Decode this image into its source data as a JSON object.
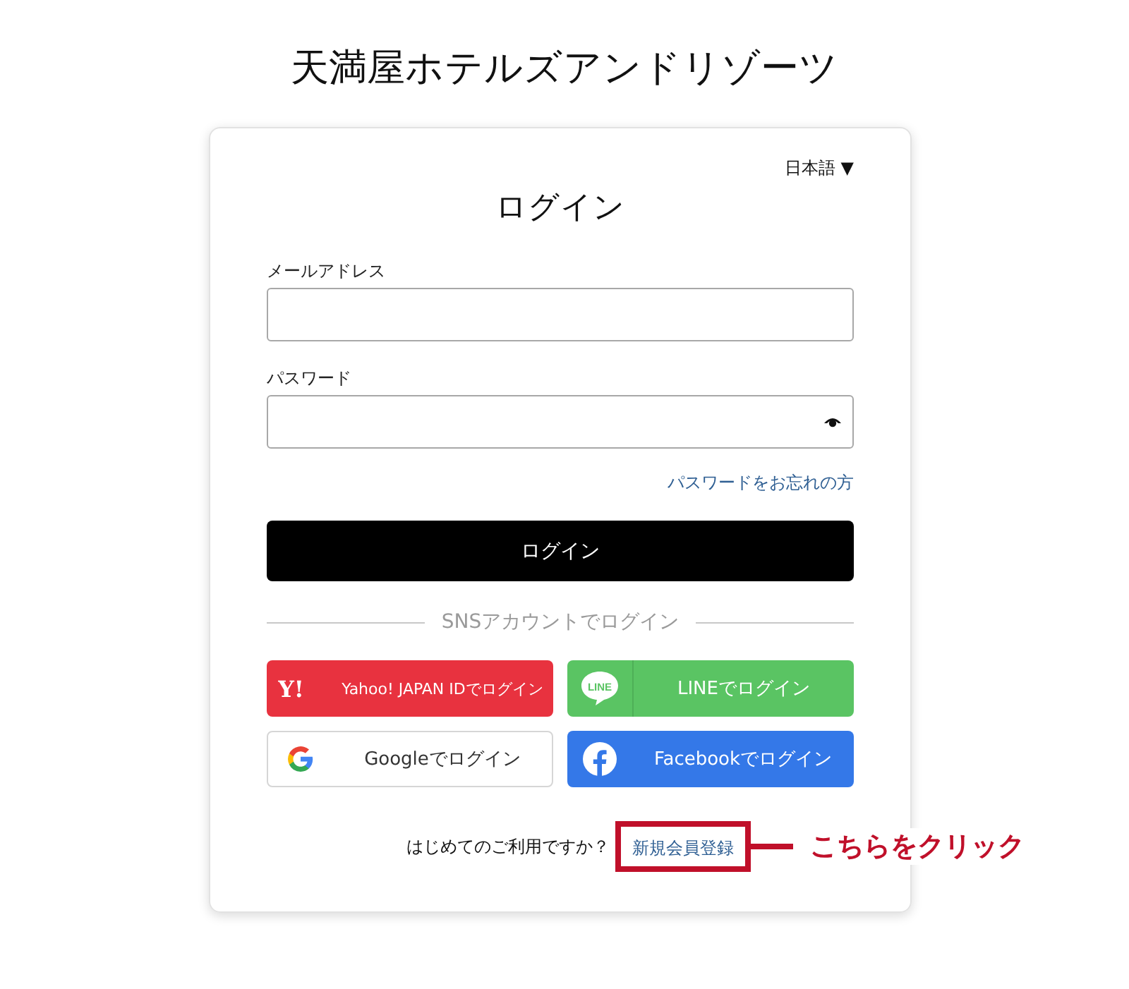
{
  "page_title": "天満屋ホテルズアンドリゾーツ",
  "language": {
    "label": "日本語",
    "caret": "▼"
  },
  "heading": "ログイン",
  "fields": [
    {
      "kind": "text",
      "label": "メールアドレス"
    },
    {
      "kind": "password",
      "label": "パスワード"
    }
  ],
  "forgot_link": "パスワードをお忘れの方",
  "login_button": "ログイン",
  "divider": "SNSアカウントでログイン",
  "sns_buttons": [
    {
      "kind": "yahoo",
      "label": "Yahoo! JAPAN IDでログイン",
      "logo": "Y!"
    },
    {
      "kind": "line",
      "label": "LINEでログイン",
      "logo": "LINE"
    },
    {
      "kind": "google",
      "label": "Googleでログイン"
    },
    {
      "kind": "facebook",
      "label": "Facebookでログイン"
    }
  ],
  "signup": {
    "prompt": "はじめてのご利用ですか？",
    "link": "新規会員登録"
  },
  "callout": {
    "text": "こちらをクリック"
  }
}
